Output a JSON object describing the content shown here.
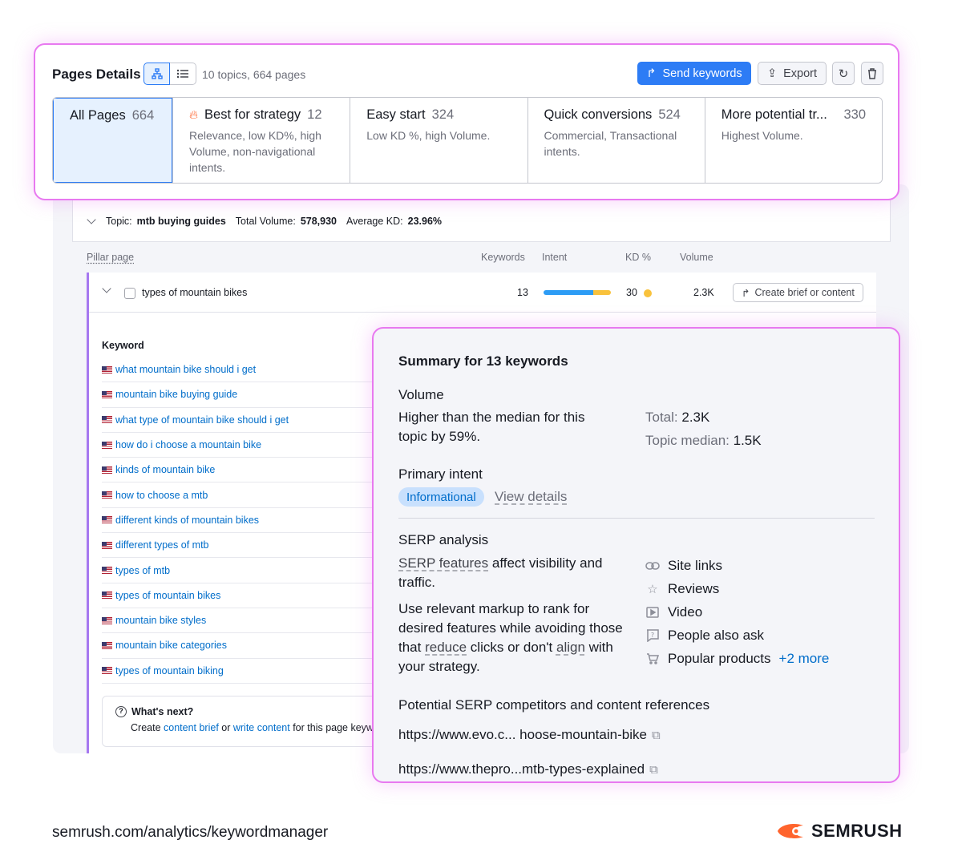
{
  "header": {
    "title": "Pages Details",
    "summary": "10 topics, 664 pages",
    "send_label": "Send keywords",
    "export_label": "Export"
  },
  "tabs": [
    {
      "title": "All Pages",
      "count": "664",
      "desc": ""
    },
    {
      "title": "Best for strategy",
      "count": "12",
      "desc": "Relevance, low KD%, high Volume, non-navigational intents."
    },
    {
      "title": "Easy start",
      "count": "324",
      "desc": "Low KD %, high Volume."
    },
    {
      "title": "Quick conversions",
      "count": "524",
      "desc": "Commercial, Transactional intents."
    },
    {
      "title": "More potential tr...",
      "count": "330",
      "desc": "Highest Volume."
    }
  ],
  "topic": {
    "label": "Topic:",
    "name": "mtb buying guides",
    "total_label": "Total Volume:",
    "total": "578,930",
    "kd_label": "Average KD:",
    "kd": "23.96%"
  },
  "columns": {
    "pillar": "Pillar page",
    "keywords": "Keywords",
    "intent": "Intent",
    "kd": "KD %",
    "volume": "Volume"
  },
  "pillar": {
    "name": "types of mountain bikes",
    "keywords": "13",
    "kd": "30",
    "volume": "2.3K",
    "brief_label": "Create brief or content"
  },
  "keyword_list": {
    "header": "Keyword",
    "items": [
      "what mountain bike should i get",
      "mountain bike buying guide",
      "what type of mountain bike should i get",
      "how do i choose a mountain bike",
      "kinds of mountain bike",
      "how to choose a mtb",
      "different kinds of mountain bikes",
      "different types of mtb",
      "types of mtb",
      "types of mountain bikes",
      "mountain bike styles",
      "mountain bike categories",
      "types of mountain biking"
    ]
  },
  "whats_next": {
    "title": "What's next?",
    "prefix": "Create ",
    "link1": "content brief",
    "mid": " or ",
    "link2": "write content",
    "suffix": " for this page keywords."
  },
  "summary": {
    "title": "Summary for 13 keywords",
    "volume_heading": "Volume",
    "volume_text": "Higher than the median for this topic by 59%.",
    "total_label": "Total:",
    "total": "2.3K",
    "median_label": "Topic median:",
    "median": "1.5K",
    "intent_heading": "Primary intent",
    "intent": "Informational",
    "view_details": "View details",
    "serp_heading": "SERP analysis",
    "serp_link": "SERP features",
    "serp_text": " affect visibility and traffic.",
    "markup_a": "Use relevant markup to rank for desired features while avoiding those that ",
    "markup_reduce": "reduce",
    "markup_b": " clicks or don't ",
    "markup_align": "align",
    "markup_c": " with your strategy.",
    "features": [
      {
        "label": "Site links",
        "icon": "link-icon"
      },
      {
        "label": "Reviews",
        "icon": "star-icon"
      },
      {
        "label": "Video",
        "icon": "video-icon"
      },
      {
        "label": "People also ask",
        "icon": "question-icon"
      },
      {
        "label": "Popular products",
        "icon": "cart-icon"
      }
    ],
    "more": "+2 more",
    "competitors_heading": "Potential SERP competitors and content references",
    "urls": [
      "https://www.evo.c... hoose-mountain-bike",
      "https://www.thepro...mtb-types-explained"
    ]
  },
  "footer": {
    "url": "semrush.com/analytics/keywordmanager",
    "brand": "SEMRUSH"
  },
  "colors": {
    "accent": "#2d7cf5",
    "highlight": "#e879f0",
    "link": "#006dca",
    "brand": "#ff642d"
  }
}
